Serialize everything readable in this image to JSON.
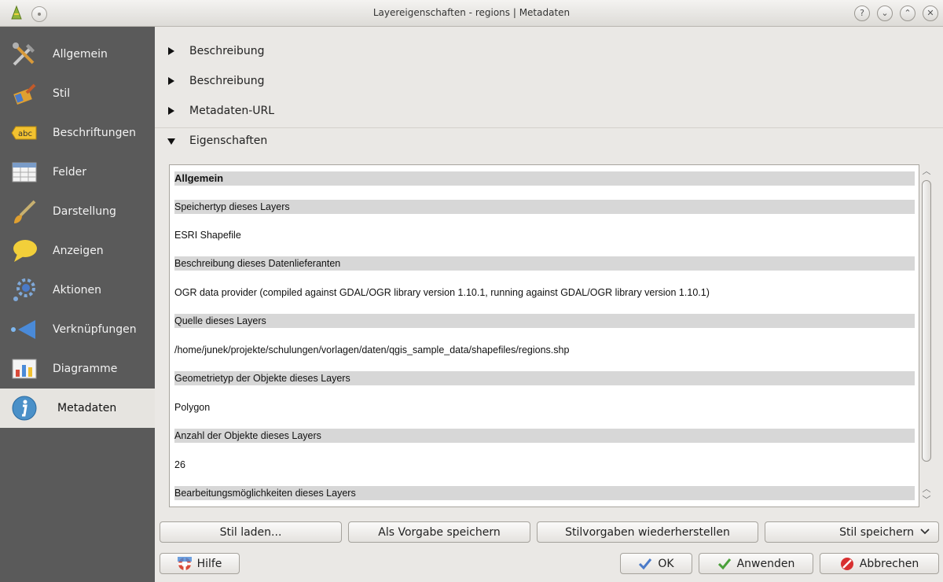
{
  "window": {
    "title": "Layereigenschaften - regions | Metadaten",
    "controls": [
      "?",
      "⌄",
      "⌃",
      "✕"
    ]
  },
  "sidebar": {
    "items": [
      {
        "label": "Allgemein",
        "icon": "tools-icon"
      },
      {
        "label": "Stil",
        "icon": "brush-icon"
      },
      {
        "label": "Beschriftungen",
        "icon": "abc-label-icon"
      },
      {
        "label": "Felder",
        "icon": "table-icon"
      },
      {
        "label": "Darstellung",
        "icon": "paintbrush-icon"
      },
      {
        "label": "Anzeigen",
        "icon": "speech-bubble-icon"
      },
      {
        "label": "Aktionen",
        "icon": "gear-run-icon"
      },
      {
        "label": "Verknüpfungen",
        "icon": "join-icon"
      },
      {
        "label": "Diagramme",
        "icon": "chart-icon"
      },
      {
        "label": "Metadaten",
        "icon": "info-icon",
        "active": true
      }
    ],
    "abc_icon_text": "abc"
  },
  "sections": [
    {
      "label": "Beschreibung",
      "expanded": false
    },
    {
      "label": "Beschreibung",
      "expanded": false
    },
    {
      "label": "Metadaten-URL",
      "expanded": false
    },
    {
      "label": "Eigenschaften",
      "expanded": true
    }
  ],
  "properties": [
    {
      "text": "Allgemein",
      "style": "title"
    },
    {
      "text": "Speichertyp dieses Layers",
      "style": "header"
    },
    {
      "text": "ESRI Shapefile",
      "style": "value"
    },
    {
      "text": "Beschreibung dieses Datenlieferanten",
      "style": "header"
    },
    {
      "text": "OGR data provider (compiled against GDAL/OGR library version 1.10.1, running against GDAL/OGR library version 1.10.1)",
      "style": "value"
    },
    {
      "text": "Quelle dieses Layers",
      "style": "header"
    },
    {
      "text": "/home/junek/projekte/schulungen/vorlagen/daten/qgis_sample_data/shapefiles/regions.shp",
      "style": "value"
    },
    {
      "text": "Geometrietyp der Objekte dieses Layers",
      "style": "header"
    },
    {
      "text": "Polygon",
      "style": "value"
    },
    {
      "text": "Anzahl der Objekte dieses Layers",
      "style": "header"
    },
    {
      "text": "26",
      "style": "value"
    },
    {
      "text": "Bearbeitungsmöglichkeiten dieses Layers",
      "style": "header"
    }
  ],
  "style_buttons": {
    "load": "Stil laden...",
    "save_default": "Als Vorgabe speichern",
    "restore_default": "Stilvorgaben wiederherstellen",
    "save": "Stil speichern"
  },
  "dialog_buttons": {
    "help": "Hilfe",
    "ok": "OK",
    "apply": "Anwenden",
    "cancel": "Abbrechen"
  },
  "colors": {
    "sidebar_bg": "#5a5a5a",
    "active_item_bg": "#e6e4e0",
    "header_row_bg": "#d7d7d7"
  }
}
